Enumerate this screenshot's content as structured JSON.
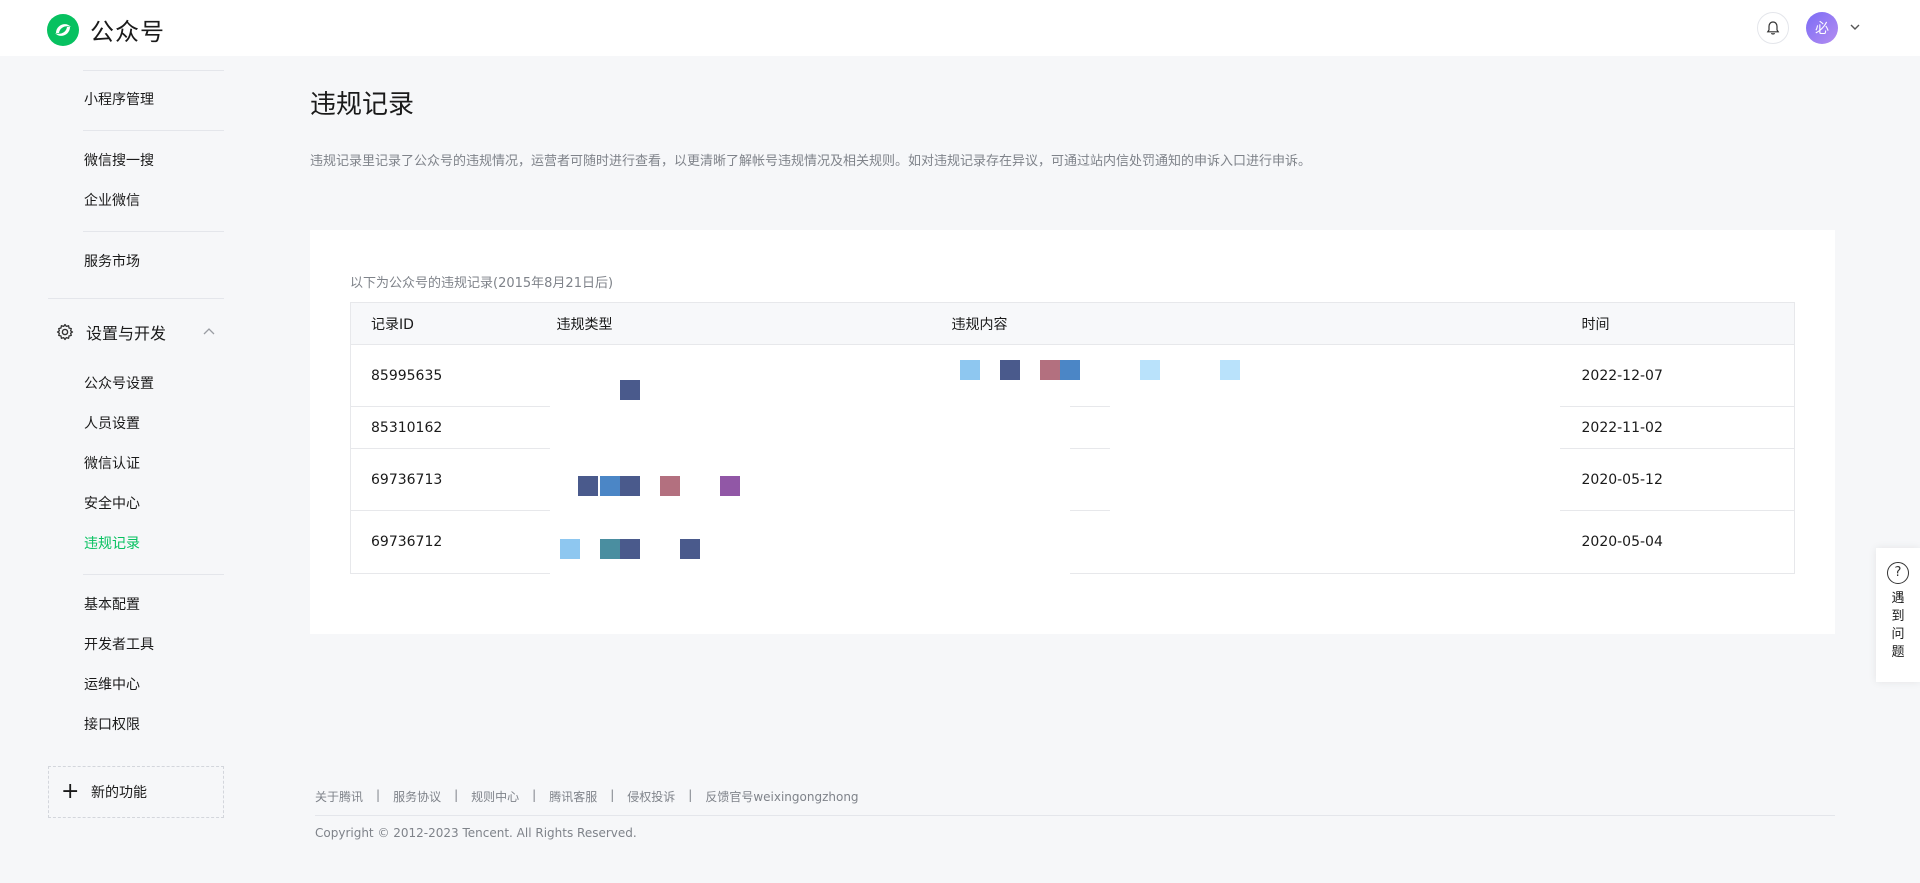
{
  "app": {
    "name": "公众号"
  },
  "header": {
    "avatar_text": "必"
  },
  "sidebar": {
    "items_top": [
      {
        "label": "小程序管理"
      },
      {
        "label": "微信搜一搜"
      },
      {
        "label": "企业微信"
      },
      {
        "label": "服务市场"
      }
    ],
    "section": {
      "label": "设置与开发"
    },
    "section_items": [
      {
        "label": "公众号设置"
      },
      {
        "label": "人员设置"
      },
      {
        "label": "微信认证"
      },
      {
        "label": "安全中心"
      },
      {
        "label": "违规记录"
      }
    ],
    "items_bottom": [
      {
        "label": "基本配置"
      },
      {
        "label": "开发者工具"
      },
      {
        "label": "运维中心"
      },
      {
        "label": "接口权限"
      }
    ],
    "new_feature": {
      "label": "新的功能"
    }
  },
  "page": {
    "title": "违规记录",
    "description": "违规记录里记录了公众号的违规情况，运营者可随时进行查看，以更清晰了解帐号违规情况及相关规则。如对违规记录存在异议，可通过站内信处罚通知的申诉入口进行申诉。",
    "caption": "以下为公众号的违规记录(2015年8月21日后)",
    "table": {
      "columns": [
        "记录ID",
        "违规类型",
        "违规内容",
        "时间"
      ],
      "rows": [
        {
          "id": "85995635",
          "type": "",
          "content": "",
          "time": "2022-12-07"
        },
        {
          "id": "85310162",
          "type": "",
          "content": "",
          "time": "2022-11-02"
        },
        {
          "id": "69736713",
          "type": "",
          "content": "",
          "time": "2020-05-12"
        },
        {
          "id": "69736712",
          "type": "",
          "content": "",
          "time": "2020-05-04"
        }
      ]
    }
  },
  "help": {
    "label": "遇到问题"
  },
  "footer": {
    "links": [
      "关于腾讯",
      "服务协议",
      "规则中心",
      "腾讯客服",
      "侵权投诉",
      "反馈官号weixingongzhong"
    ],
    "copyright": "Copyright © 2012-2023 Tencent. All Rights Reserved."
  },
  "colors": {
    "accent": "#07c160",
    "muted_text": "#7f838a"
  }
}
